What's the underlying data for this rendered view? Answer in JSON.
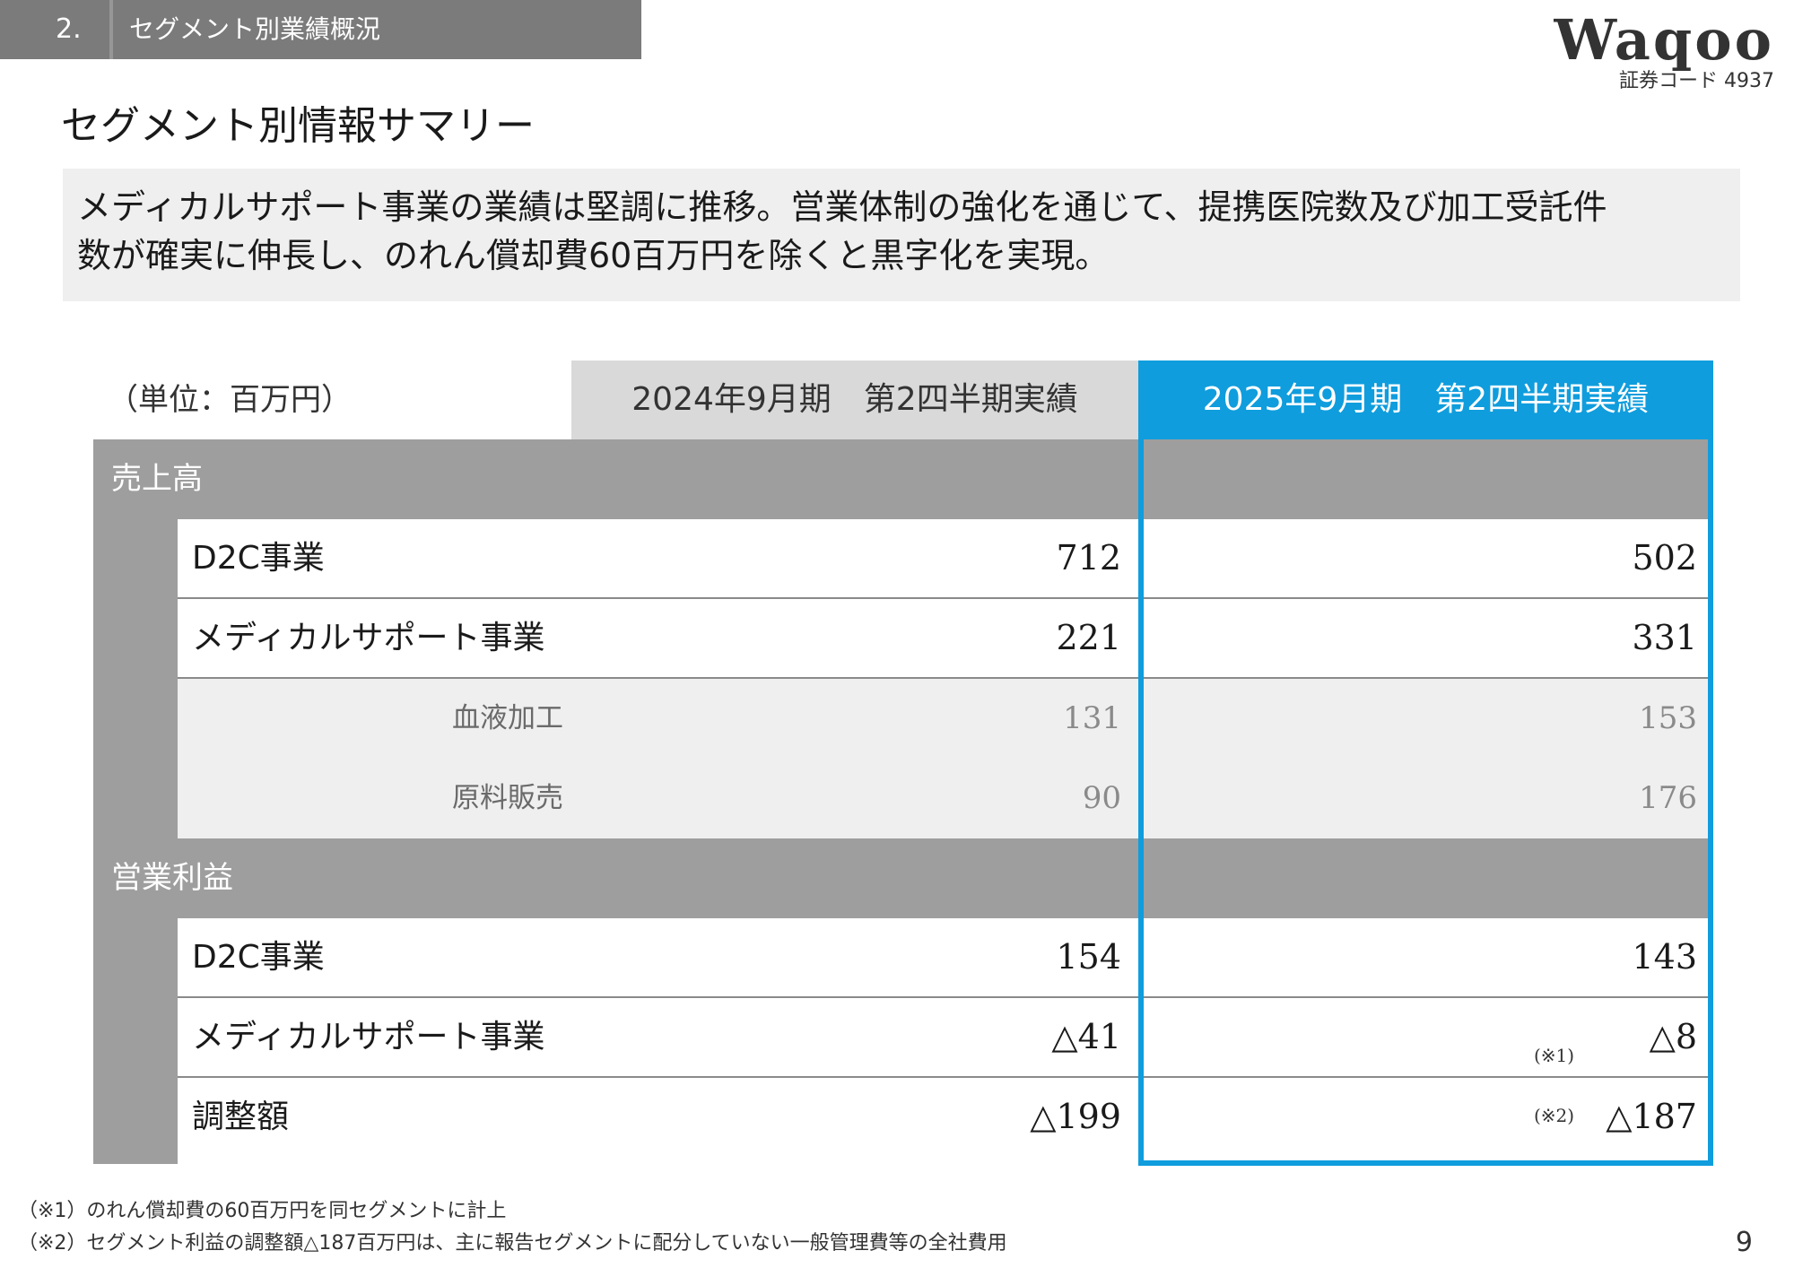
{
  "header": {
    "section_number": "2.",
    "section_title": "セグメント別業績概況",
    "logo_text": "Waqoo",
    "stock_code": "証券コード 4937"
  },
  "page_title": "セグメント別情報サマリー",
  "summary": {
    "line1": "メディカルサポート事業の業績は堅調に推移。営業体制の強化を通じて、提携医院数及び加工受託件",
    "line2": "数が確実に伸長し、のれん償却費60百万円を除くと黒字化を実現。"
  },
  "table": {
    "unit_label": "（単位：百万円）",
    "col_2024": "2024年9月期　第2四半期実績",
    "col_2025": "2025年9月期　第2四半期実績",
    "sales": {
      "label": "売上高",
      "rows": [
        {
          "label": "D2C事業",
          "v2024": "712",
          "v2025": "502"
        },
        {
          "label": "メディカルサポート事業",
          "v2024": "221",
          "v2025": "331"
        },
        {
          "label": "血液加工",
          "v2024": "131",
          "v2025": "153"
        },
        {
          "label": "原料販売",
          "v2024": "90",
          "v2025": "176"
        }
      ]
    },
    "profit": {
      "label": "営業利益",
      "rows": [
        {
          "label": "D2C事業",
          "v2024": "154",
          "v2025": "143"
        },
        {
          "label": "メディカルサポート事業",
          "v2024": "△41",
          "v2025": "△8",
          "note": "(※1)"
        },
        {
          "label": "調整額",
          "v2024": "△199",
          "v2025": "△187",
          "note": "(※2)"
        }
      ]
    }
  },
  "footnotes": {
    "note1": "（※1）のれん償却費の60百万円を同セグメントに計上",
    "note2": "（※2）セグメント利益の調整額△187百万円は、主に報告セグメントに配分していない一般管理費等の全社費用"
  },
  "page_number": "9",
  "colors": {
    "accent": "#0f9ddd",
    "header_gray": "#7b7b7b",
    "group_gray": "#9e9e9e"
  }
}
